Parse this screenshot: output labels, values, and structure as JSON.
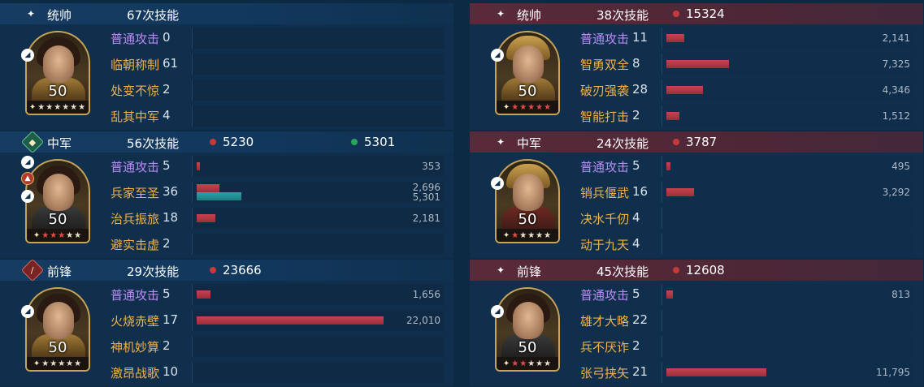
{
  "left": [
    {
      "position": "统帅",
      "skills_count": "67次技能",
      "stats": [],
      "level": "50",
      "stars_on": 0,
      "stars_total": 6,
      "skills": [
        {
          "name": "普通攻击",
          "count": "0",
          "normal": true,
          "bars": []
        },
        {
          "name": "临朝称制",
          "count": "61",
          "bars": []
        },
        {
          "name": "处变不惊",
          "count": "2",
          "bars": []
        },
        {
          "name": "乱其中军",
          "count": "4",
          "bars": []
        }
      ]
    },
    {
      "position": "中军",
      "skills_count": "56次技能",
      "stats": [
        {
          "color": "red",
          "value": "5230"
        },
        {
          "color": "green",
          "value": "5301"
        }
      ],
      "level": "50",
      "stars_on": 3,
      "stars_total": 5,
      "skills": [
        {
          "name": "普通攻击",
          "count": "5",
          "normal": true,
          "bars": [
            {
              "color": "red",
              "value": 353,
              "label": "353"
            }
          ]
        },
        {
          "name": "兵家至圣",
          "count": "36",
          "bars": [
            {
              "color": "red",
              "value": 2696,
              "label": "2,696"
            },
            {
              "color": "green",
              "value": 5301,
              "label": "5,301"
            }
          ]
        },
        {
          "name": "治兵振旅",
          "count": "18",
          "bars": [
            {
              "color": "red",
              "value": 2181,
              "label": "2,181"
            }
          ]
        },
        {
          "name": "避实击虚",
          "count": "2",
          "bars": []
        }
      ]
    },
    {
      "position": "前锋",
      "skills_count": "29次技能",
      "stats": [
        {
          "color": "red",
          "value": "23666"
        }
      ],
      "level": "50",
      "stars_on": 0,
      "stars_total": 5,
      "skills": [
        {
          "name": "普通攻击",
          "count": "5",
          "normal": true,
          "bars": [
            {
              "color": "red",
              "value": 1656,
              "label": "1,656"
            }
          ]
        },
        {
          "name": "火烧赤壁",
          "count": "17",
          "bars": [
            {
              "color": "red",
              "value": 22010,
              "label": "22,010"
            }
          ]
        },
        {
          "name": "神机妙算",
          "count": "2",
          "bars": []
        },
        {
          "name": "激昂战歌",
          "count": "10",
          "bars": []
        }
      ]
    }
  ],
  "right": [
    {
      "position": "统帅",
      "skills_count": "38次技能",
      "stats": [
        {
          "color": "red",
          "value": "15324"
        }
      ],
      "level": "50",
      "stars_on": 5,
      "stars_total": 5,
      "skills": [
        {
          "name": "普通攻击",
          "count": "11",
          "normal": true,
          "bars": [
            {
              "color": "red",
              "value": 2141,
              "label": "2,141"
            }
          ]
        },
        {
          "name": "智勇双全",
          "count": "8",
          "bars": [
            {
              "color": "red",
              "value": 7325,
              "label": "7,325"
            }
          ]
        },
        {
          "name": "破刃强袭",
          "count": "28",
          "bars": [
            {
              "color": "red",
              "value": 4346,
              "label": "4,346"
            }
          ]
        },
        {
          "name": "智能打击",
          "count": "2",
          "bars": [
            {
              "color": "red",
              "value": 1512,
              "label": "1,512"
            }
          ]
        }
      ]
    },
    {
      "position": "中军",
      "skills_count": "24次技能",
      "stats": [
        {
          "color": "red",
          "value": "3787"
        }
      ],
      "level": "50",
      "stars_on": 1,
      "stars_total": 5,
      "skills": [
        {
          "name": "普通攻击",
          "count": "5",
          "normal": true,
          "bars": [
            {
              "color": "red",
              "value": 495,
              "label": "495"
            }
          ]
        },
        {
          "name": "销兵偃武",
          "count": "16",
          "bars": [
            {
              "color": "red",
              "value": 3292,
              "label": "3,292"
            }
          ]
        },
        {
          "name": "决水千仞",
          "count": "4",
          "bars": []
        },
        {
          "name": "动于九天",
          "count": "4",
          "bars": []
        }
      ]
    },
    {
      "position": "前锋",
      "skills_count": "45次技能",
      "stats": [
        {
          "color": "red",
          "value": "12608"
        }
      ],
      "level": "50",
      "stars_on": 2,
      "stars_total": 5,
      "skills": [
        {
          "name": "普通攻击",
          "count": "5",
          "normal": true,
          "bars": [
            {
              "color": "red",
              "value": 813,
              "label": "813"
            }
          ]
        },
        {
          "name": "雄才大略",
          "count": "22",
          "bars": []
        },
        {
          "name": "兵不厌诈",
          "count": "2",
          "bars": []
        },
        {
          "name": "张弓挟矢",
          "count": "21",
          "bars": [
            {
              "color": "red",
              "value": 11795,
              "label": "11,795"
            }
          ]
        }
      ]
    }
  ],
  "bar_max_value": 22010
}
